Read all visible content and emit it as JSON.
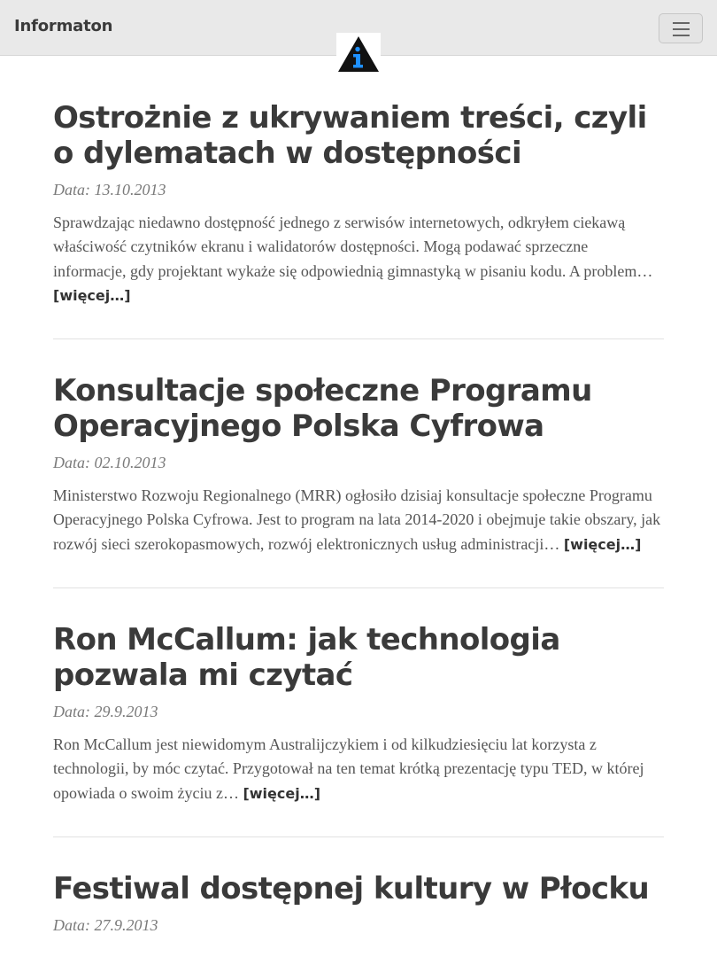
{
  "header": {
    "brand": "Informaton",
    "logo_icon": "info-triangle-logo",
    "menu_icon": "hamburger-menu-icon"
  },
  "posts": [
    {
      "title": "Ostrożnie z ukrywaniem treści, czyli o dylematach w dostępności",
      "date": "Data: 13.10.2013",
      "excerpt": "Sprawdzając niedawno dostępność jednego z serwisów internetowych, odkryłem ciekawą właściwość czytników ekranu i walidatorów dostępności. Mogą podawać sprzeczne informacje, gdy projektant wykaże się odpowiednią gimnastyką w pisaniu kodu. A problem…",
      "more": "[więcej…]"
    },
    {
      "title": "Konsultacje społeczne Programu Operacyjnego Polska Cyfrowa",
      "date": "Data: 02.10.2013",
      "excerpt": "Ministerstwo Rozwoju Regionalnego (MRR) ogłosiło dzisiaj konsultacje społeczne Programu Operacyjnego Polska Cyfrowa. Jest to program na lata 2014-2020 i obejmuje takie obszary, jak rozwój sieci szerokopasmowych, rozwój elektronicznych usług administracji…",
      "more": "[więcej…]"
    },
    {
      "title": "Ron McCallum: jak technologia pozwala mi czytać",
      "date": "Data: 29.9.2013",
      "excerpt": "Ron McCallum jest niewidomym Australijczykiem i od kilkudziesięciu lat korzysta z technologii, by móc czytać. Przygotował na ten temat krótką prezentację typu TED, w której opowiada o swoim życiu z…",
      "more": "[więcej…]"
    },
    {
      "title": "Festiwal dostępnej kultury w Płocku",
      "date": "Data: 27.9.2013"
    }
  ]
}
